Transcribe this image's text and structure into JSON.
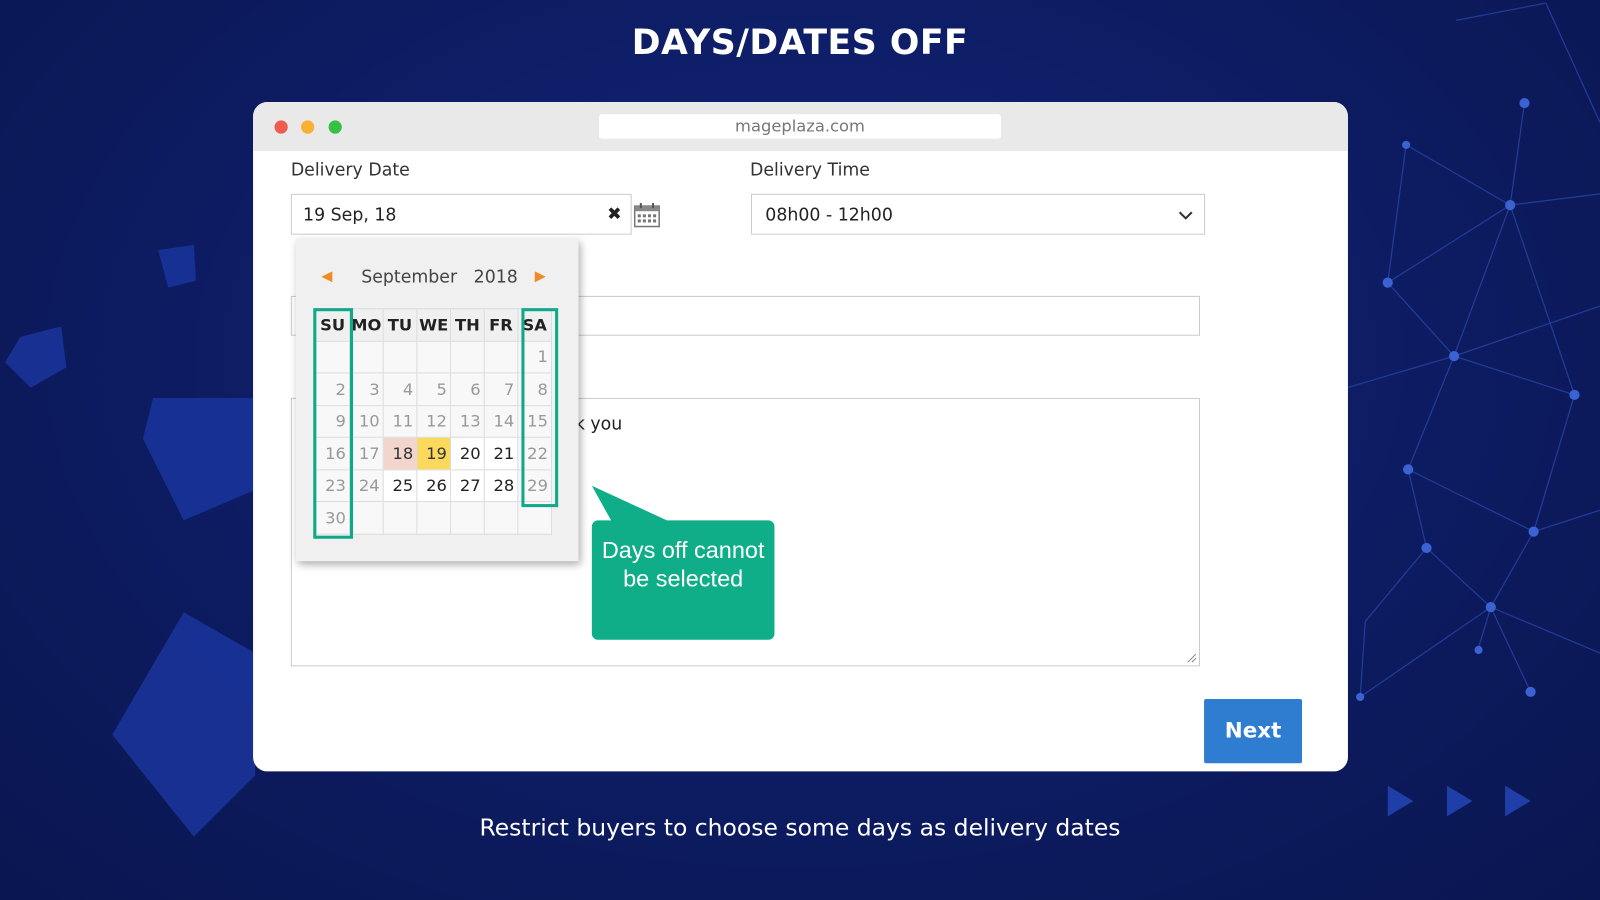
{
  "heading": "DAYS/DATES OFF",
  "subheading": "Restrict buyers to choose some days as delivery dates",
  "browser": {
    "url": "mageplaza.com",
    "dots": [
      "#ee5b4f",
      "#f6b230",
      "#37c046"
    ]
  },
  "form": {
    "delivery_date_label": "Delivery Date",
    "delivery_date_value": "19 Sep, 18",
    "clear_icon": "x-icon",
    "calendar_icon": "calendar-icon",
    "delivery_time_label": "Delivery Time",
    "delivery_time_value": "08h00 - 12h00",
    "comment_text": "Thank you",
    "next_label": "Next"
  },
  "calendar": {
    "month": "September",
    "year": "2018",
    "weekdays": [
      "SU",
      "MO",
      "TU",
      "WE",
      "TH",
      "FR",
      "SA"
    ],
    "weeks": [
      [
        null,
        null,
        null,
        null,
        null,
        null,
        1
      ],
      [
        2,
        3,
        4,
        5,
        6,
        7,
        8
      ],
      [
        9,
        10,
        11,
        12,
        13,
        14,
        15
      ],
      [
        16,
        17,
        18,
        19,
        20,
        21,
        22
      ],
      [
        23,
        24,
        25,
        26,
        27,
        28,
        29
      ],
      [
        30,
        null,
        null,
        null,
        null,
        null,
        null
      ]
    ],
    "today": 18,
    "selected": 19,
    "enabled_days": [
      18,
      19,
      20,
      21,
      25,
      26,
      27,
      28
    ],
    "days_off_columns": [
      "SU",
      "SA"
    ]
  },
  "callout": {
    "text": "Days off cannot be selected"
  },
  "colors": {
    "accent_green": "#0fae89",
    "button_blue": "#2e7dd1",
    "selected": "#fbd95d",
    "today": "#f2d5cd",
    "nav_arrow": "#f08a24"
  }
}
